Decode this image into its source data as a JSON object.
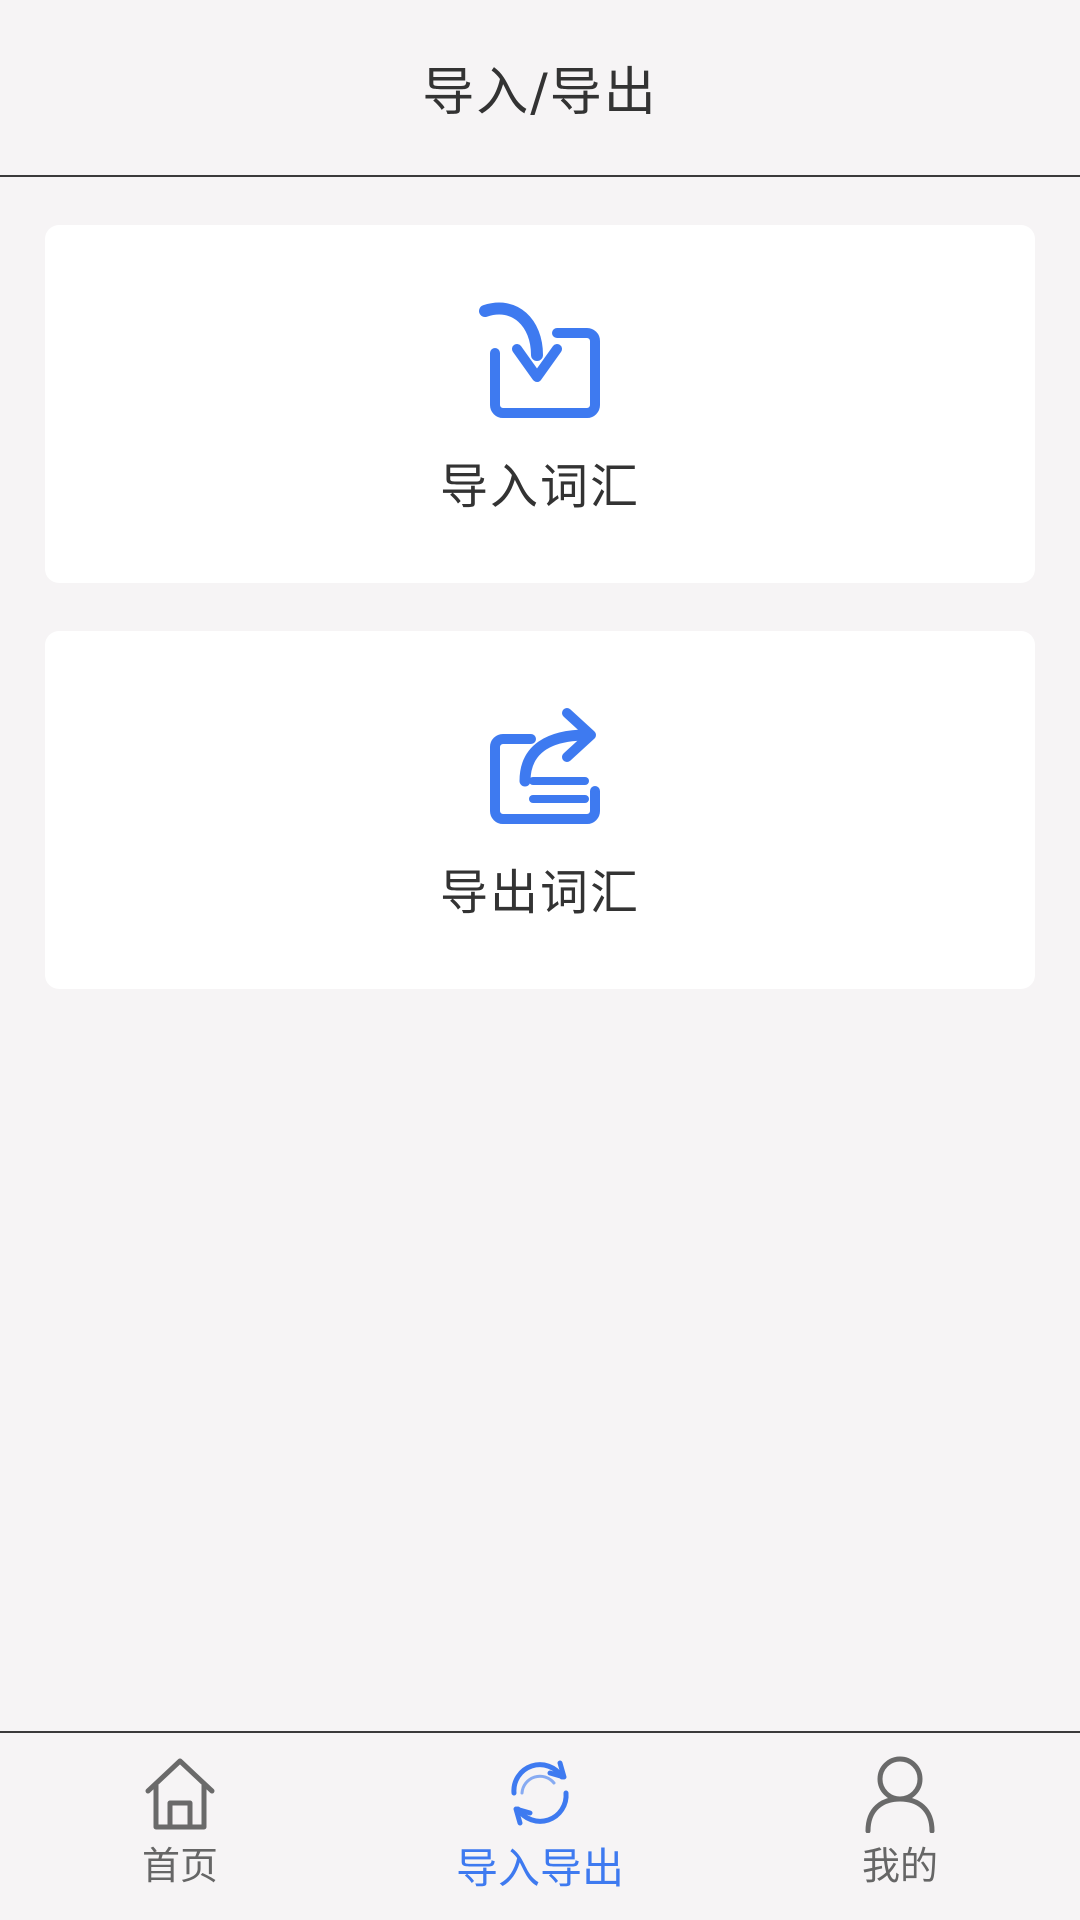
{
  "header": {
    "title": "导入/导出"
  },
  "cards": {
    "import": {
      "label": "导入词汇",
      "icon": "import-icon"
    },
    "export": {
      "label": "导出词汇",
      "icon": "export-icon"
    }
  },
  "tabbar": {
    "home": {
      "label": "首页",
      "icon": "home-icon"
    },
    "io": {
      "label": "导入导出",
      "icon": "sync-icon",
      "active": true
    },
    "me": {
      "label": "我的",
      "icon": "user-icon"
    }
  },
  "colors": {
    "accent": "#3e7af0",
    "text": "#333333",
    "inactive": "#666666",
    "background": "#f6f4f5",
    "card": "#ffffff"
  }
}
